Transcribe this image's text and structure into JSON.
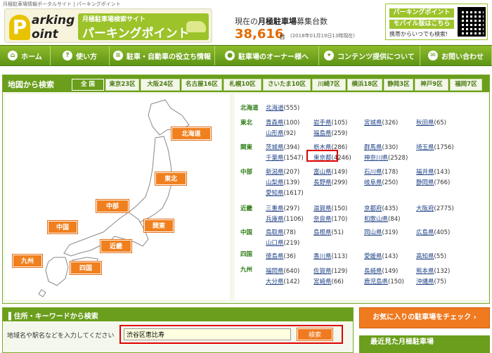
{
  "header": {
    "topline": "月極駐車場情報ポータルサイト | パーキングポイント",
    "logo": {
      "p": "P",
      "w1": "arking",
      "w2": "oint",
      "tagline": "月極駐車場検索サイト",
      "name": "パーキングポイント"
    },
    "count_label_pre": "現在の",
    "count_label_bold": "月極駐車場",
    "count_label_post": "募集台数",
    "count": "38,616",
    "count_unit": "台",
    "count_date": "(2018年01月19日13時現在)",
    "mobile": {
      "line1": "パーキングポイント",
      "line2": "モバイル版はこちら",
      "line3": "携帯からいつでも検索!"
    }
  },
  "nav": [
    {
      "label": "ホーム",
      "icon": "house-icon",
      "glyph": "⌂"
    },
    {
      "label": "使い方",
      "icon": "question-icon",
      "glyph": "?"
    },
    {
      "label": "駐車・自動車の役立ち情報",
      "icon": "document-icon",
      "glyph": "≡"
    },
    {
      "label": "駐車場のオーナー様へ",
      "icon": "person-icon",
      "glyph": "●"
    },
    {
      "label": "コンテンツ提供について",
      "icon": "puzzle-icon",
      "glyph": "✦"
    },
    {
      "label": "お問い合わせ",
      "icon": "mail-icon",
      "glyph": "✉"
    }
  ],
  "map_search": {
    "title": "地図から検索",
    "tabs": [
      "全 国",
      "東京23区",
      "大阪24区",
      "名古屋16区",
      "札幌10区",
      "さいたま10区",
      "川崎7区",
      "横浜18区",
      "静岡3区",
      "神戸9区",
      "福岡7区"
    ],
    "map_labels": [
      "北海道",
      "東北",
      "中部",
      "関東",
      "中国",
      "近畿",
      "九州",
      "四国"
    ],
    "regions": [
      "北海道",
      "東北",
      "関東",
      "中部",
      "近畿",
      "中国",
      "四国",
      "九州"
    ],
    "prefs": [
      {
        "name": "北海道",
        "count": "(555)"
      },
      {
        "name": "青森県",
        "count": "(100)"
      },
      {
        "name": "岩手県",
        "count": "(105)"
      },
      {
        "name": "宮城県",
        "count": "(326)"
      },
      {
        "name": "秋田県",
        "count": "(65)"
      },
      {
        "name": "山形県",
        "count": "(92)"
      },
      {
        "name": "福島県",
        "count": "(259)"
      },
      {
        "name": "茨城県",
        "count": "(394)"
      },
      {
        "name": "栃木県",
        "count": "(286)"
      },
      {
        "name": "群馬県",
        "count": "(330)"
      },
      {
        "name": "埼玉県",
        "count": "(1756)"
      },
      {
        "name": "千葉県",
        "count": "(1547)"
      },
      {
        "name": "東京都",
        "count": "(4246)"
      },
      {
        "name": "神奈川県",
        "count": "(2528)"
      },
      {
        "name": "新潟県",
        "count": "(207)"
      },
      {
        "name": "富山県",
        "count": "(149)"
      },
      {
        "name": "石川県",
        "count": "(178)"
      },
      {
        "name": "福井県",
        "count": "(143)"
      },
      {
        "name": "山梨県",
        "count": "(139)"
      },
      {
        "name": "長野県",
        "count": "(299)"
      },
      {
        "name": "岐阜県",
        "count": "(250)"
      },
      {
        "name": "静岡県",
        "count": "(766)"
      },
      {
        "name": "愛知県",
        "count": "(1617)"
      },
      {
        "name": "三重県",
        "count": "(297)"
      },
      {
        "name": "滋賀県",
        "count": "(150)"
      },
      {
        "name": "京都府",
        "count": "(435)"
      },
      {
        "name": "大阪府",
        "count": "(2775)"
      },
      {
        "name": "兵庫県",
        "count": "(1106)"
      },
      {
        "name": "奈良県",
        "count": "(170)"
      },
      {
        "name": "和歌山県",
        "count": "(84)"
      },
      {
        "name": "鳥取県",
        "count": "(78)"
      },
      {
        "name": "島根県",
        "count": "(51)"
      },
      {
        "name": "岡山県",
        "count": "(319)"
      },
      {
        "name": "広島県",
        "count": "(405)"
      },
      {
        "name": "山口県",
        "count": "(219)"
      },
      {
        "name": "徳島県",
        "count": "(36)"
      },
      {
        "name": "香川県",
        "count": "(113)"
      },
      {
        "name": "愛媛県",
        "count": "(143)"
      },
      {
        "name": "高知県",
        "count": "(55)"
      },
      {
        "name": "福岡県",
        "count": "(640)"
      },
      {
        "name": "佐賀県",
        "count": "(129)"
      },
      {
        "name": "長崎県",
        "count": "(149)"
      },
      {
        "name": "熊本県",
        "count": "(132)"
      },
      {
        "name": "大分県",
        "count": "(142)"
      },
      {
        "name": "宮崎県",
        "count": "(66)"
      },
      {
        "name": "鹿児島県",
        "count": "(150)"
      },
      {
        "name": "沖縄県",
        "count": "(75)"
      }
    ]
  },
  "keyword": {
    "title": "住所・キーワードから検索",
    "label": "地域名や駅名などを入力してください",
    "value": "渋谷区恵比寿",
    "button": "検索"
  },
  "sidebar": {
    "favorites": "お気に入りの駐車場をチェック",
    "recent": "最近見た月極駐車場"
  },
  "colors": {
    "accent_green": "#6a9e1c",
    "accent_orange": "#f07a20",
    "count_orange": "#e26a00",
    "highlight_red": "#e00000"
  }
}
